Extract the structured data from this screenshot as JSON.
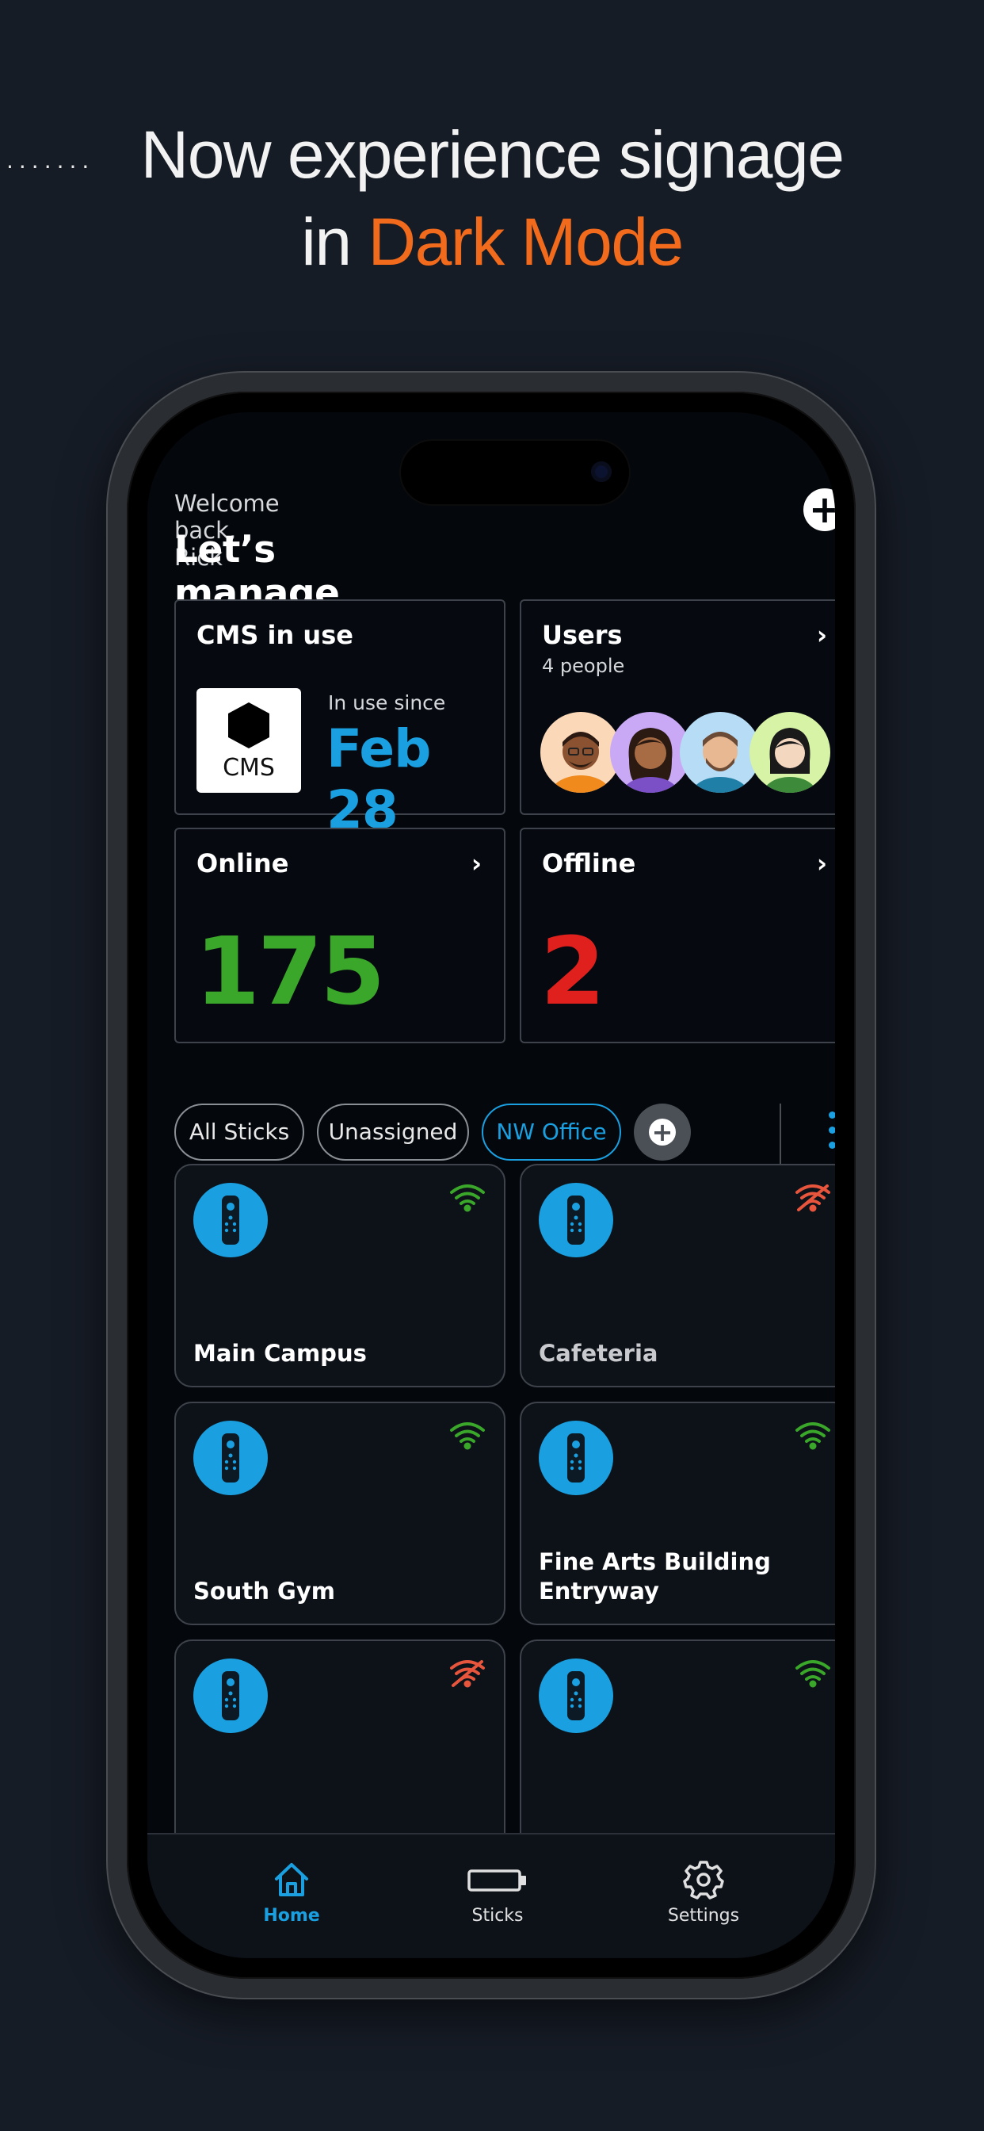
{
  "promo": {
    "dots": "·······",
    "headline_line1": "Now experience signage",
    "headline_line2_prefix": "in ",
    "headline_line2_accent": "Dark Mode"
  },
  "header": {
    "welcome": "Welcome back, Rick",
    "title": "Let’s manage your Sticks",
    "add_icon": "plus-circle-icon"
  },
  "cards": {
    "cms": {
      "title": "CMS in use",
      "logo_text": "CMS",
      "since_label": "In use since",
      "since_date": "Feb 28"
    },
    "users": {
      "title": "Users",
      "subtitle": "4 people",
      "avatar_count": 4
    },
    "online": {
      "title": "Online",
      "count": "175",
      "color": "#3aa62a"
    },
    "offline": {
      "title": "Offline",
      "count": "2",
      "color": "#e0201c"
    }
  },
  "filters": {
    "chips": [
      "All Sticks",
      "Unassigned",
      "NW Office"
    ],
    "active": "NW Office"
  },
  "sticks": [
    {
      "name": "Main Campus",
      "status": "online"
    },
    {
      "name": "Cafeteria",
      "status": "offline"
    },
    {
      "name": "South Gym",
      "status": "online"
    },
    {
      "name": "Fine Arts Building Entryway",
      "status": "online"
    },
    {
      "name": "",
      "status": "offline"
    },
    {
      "name": "",
      "status": "online"
    }
  ],
  "colors": {
    "accent": "#1aa0e0",
    "brand_orange": "#f26a1b",
    "wifi_on": "#3aa62a",
    "wifi_off": "#e8553d"
  },
  "tabbar": {
    "tabs": [
      {
        "label": "Home",
        "icon": "home-icon",
        "active": true
      },
      {
        "label": "Sticks",
        "icon": "stick-icon",
        "active": false
      },
      {
        "label": "Settings",
        "icon": "gear-icon",
        "active": false
      }
    ]
  }
}
